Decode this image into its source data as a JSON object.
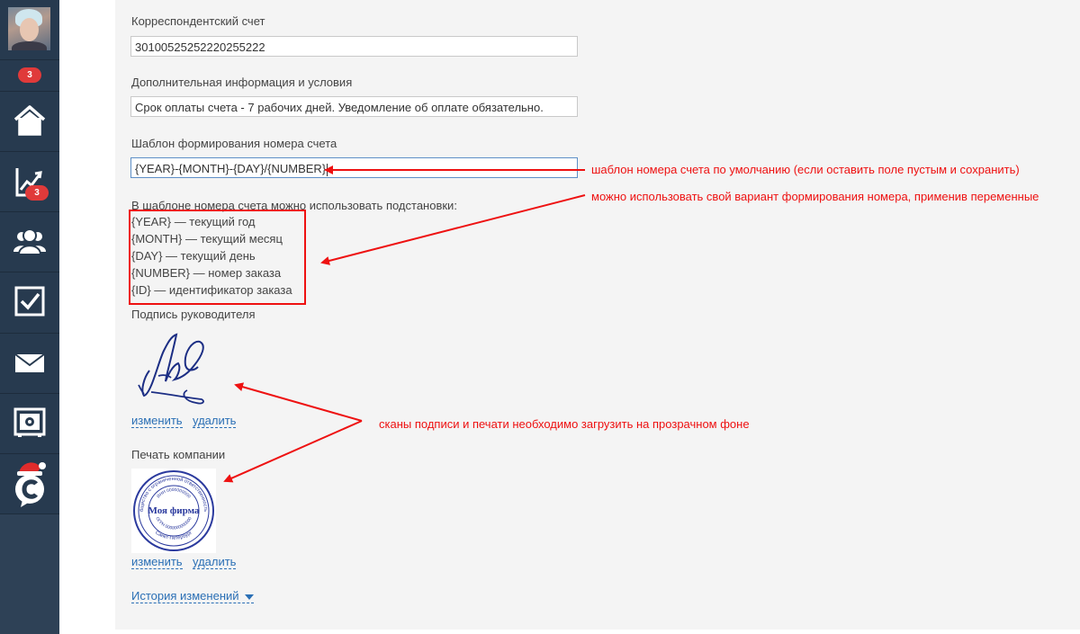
{
  "sidebar": {
    "badges": [
      "3",
      "3"
    ],
    "nav": [
      {
        "name": "home"
      },
      {
        "name": "analytics"
      },
      {
        "name": "contacts"
      },
      {
        "name": "tasks"
      },
      {
        "name": "mail"
      },
      {
        "name": "safe"
      },
      {
        "name": "brand-logo"
      }
    ]
  },
  "form": {
    "corr_account": {
      "label": "Корреспондентский счет",
      "value": "30100525252220255222"
    },
    "extra_info": {
      "label": "Дополнительная информация и условия",
      "value": "Срок оплаты счета - 7 рабочих дней. Уведомление об оплате обязательно."
    },
    "number_template": {
      "label": "Шаблон формирования номера счета",
      "value": "{YEAR}-{MONTH}-{DAY}/{NUMBER}"
    },
    "hint_title": "В шаблоне номера счета можно использовать подстановки:",
    "hints": [
      "{YEAR} — текущий год",
      "{MONTH} — текущий месяц",
      "{DAY} — текущий день",
      "{NUMBER} — номер заказа",
      "{ID} — идентификатор заказа"
    ],
    "signature": {
      "label": "Подпись руководителя",
      "change": "изменить",
      "delete": "удалить"
    },
    "stamp": {
      "label": "Печать компании",
      "change": "изменить",
      "delete": "удалить",
      "center_text": "Моя фирма",
      "ring_text": "Общество с ограниченной ответственностью",
      "inn_text": "ИНН 0000000000",
      "ogrn_text": "ОГРН 0000000000000",
      "city_text": "Санкт-Петербург"
    },
    "history": "История изменений"
  },
  "annotations": {
    "default_template": "шаблон номера счета по умолчанию (если оставить поле пустым и сохранить)",
    "own_variant": "можно использовать свой вариант формирования номера, применив переменные",
    "scans": "сканы подписи и печати необходимо загрузить на прозрачном фоне"
  },
  "colors": {
    "sidebar_bg": "#273a4f",
    "badge": "#e03a3a",
    "annotation_red": "#e11111",
    "link_blue": "#2a6fb5",
    "stamp_blue": "#2b3a9e"
  }
}
